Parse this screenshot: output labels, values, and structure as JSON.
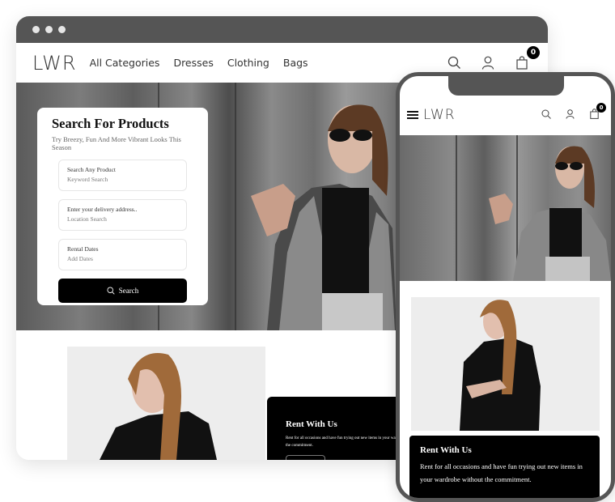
{
  "desktop": {
    "window_dots": [
      "close",
      "minimize",
      "maximize"
    ],
    "nav": {
      "logo": "LWR",
      "links": [
        "All Categories",
        "Dresses",
        "Clothing",
        "Bags"
      ],
      "icons": [
        "search-icon",
        "user-icon",
        "shopping-bag-icon"
      ],
      "cart_count": "0"
    },
    "search_card": {
      "title": "Search For Products",
      "subtitle": "Try Breezy, Fun And More Vibrant Looks This Season",
      "fields": [
        {
          "label": "Search Any Product",
          "value": "Keyword Search"
        },
        {
          "label": "Enter your delivery address..",
          "value": "Location Search"
        },
        {
          "label": "Rental Dates",
          "value": "Add Dates"
        }
      ],
      "button_label": "Search"
    },
    "rent": {
      "title": "Rent With Us",
      "text_line1": "Rent for all occasions and have fun trying out new items in your wardrobe without",
      "text_line2": "the commitment."
    }
  },
  "mobile": {
    "nav": {
      "logo": "LWR",
      "icons": [
        "menu-icon",
        "search-icon",
        "user-icon",
        "shopping-bag-icon"
      ],
      "cart_count": "0"
    },
    "rent": {
      "title": "Rent With Us",
      "text": "Rent for all occasions and have fun trying out new items in your wardrobe without the commitment."
    }
  },
  "colors": {
    "frame": "#555555",
    "accent": "#000000",
    "background": "#ffffff"
  }
}
